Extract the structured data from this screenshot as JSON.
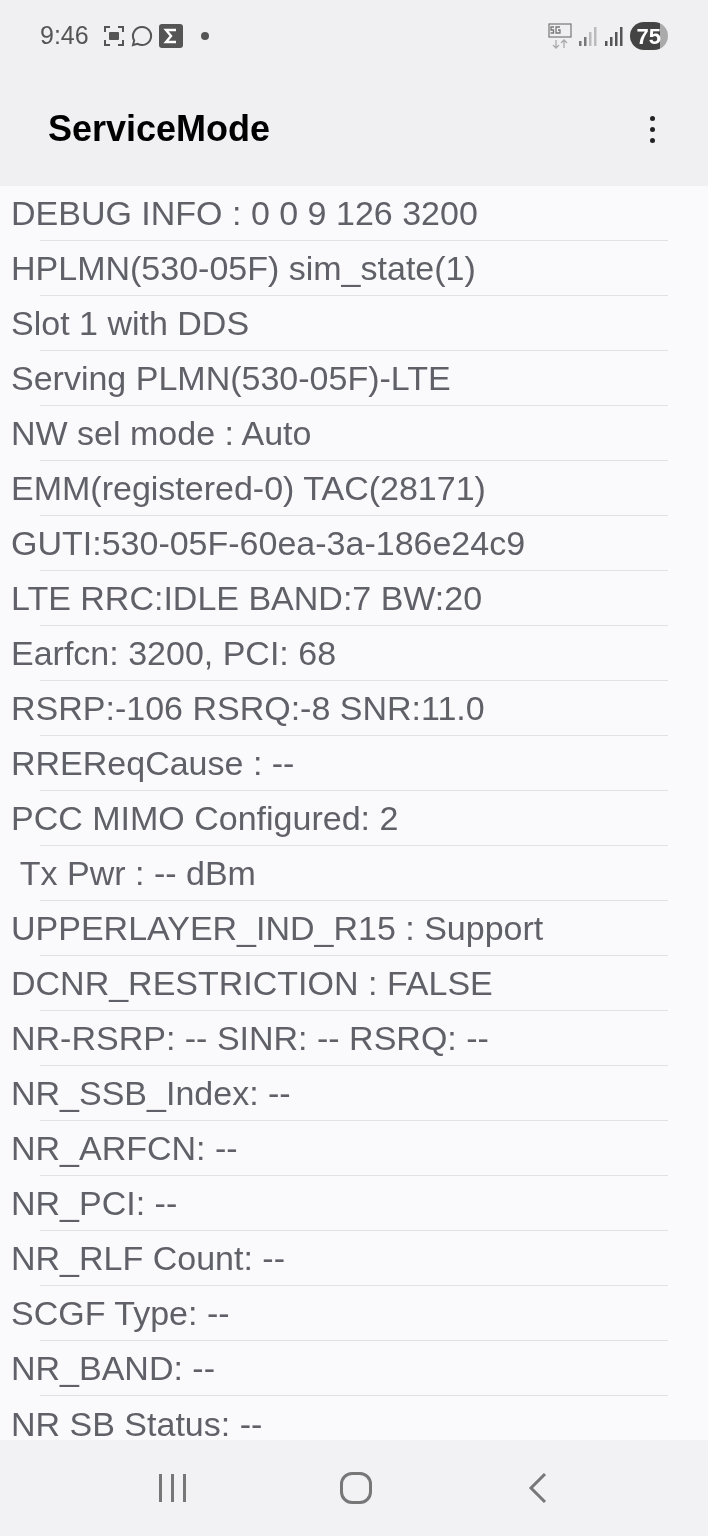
{
  "status_bar": {
    "time": "9:46",
    "battery": "75"
  },
  "app_bar": {
    "title": "ServiceMode"
  },
  "rows": [
    {
      "text": "DEBUG INFO : 0 0 9 126 3200"
    },
    {
      "text": "HPLMN(530-05F) sim_state(1)"
    },
    {
      "text": "Slot 1 with DDS"
    },
    {
      "text": "Serving PLMN(530-05F)-LTE"
    },
    {
      "text": "NW sel mode : Auto"
    },
    {
      "text": "EMM(registered-0) TAC(28171)"
    },
    {
      "text": "GUTI:530-05F-60ea-3a-186e24c9"
    },
    {
      "text": "LTE RRC:IDLE BAND:7 BW:20"
    },
    {
      "text": "Earfcn: 3200, PCI: 68"
    },
    {
      "text": "RSRP:-106 RSRQ:-8 SNR:11.0"
    },
    {
      "text": "RREReqCause : --"
    },
    {
      "text": "PCC MIMO Configured: 2"
    },
    {
      "text": " Tx Pwr : -- dBm"
    },
    {
      "text": "UPPERLAYER_IND_R15 : Support"
    },
    {
      "text": "DCNR_RESTRICTION : FALSE"
    },
    {
      "text": "NR-RSRP: -- SINR: -- RSRQ: --"
    },
    {
      "text": "NR_SSB_Index: --"
    },
    {
      "text": "NR_ARFCN: --"
    },
    {
      "text": "NR_PCI: --"
    },
    {
      "text": "NR_RLF Count: --"
    },
    {
      "text": "SCGF Type: --"
    },
    {
      "text": "NR_BAND: --"
    },
    {
      "text": "NR SB Status: --"
    }
  ]
}
